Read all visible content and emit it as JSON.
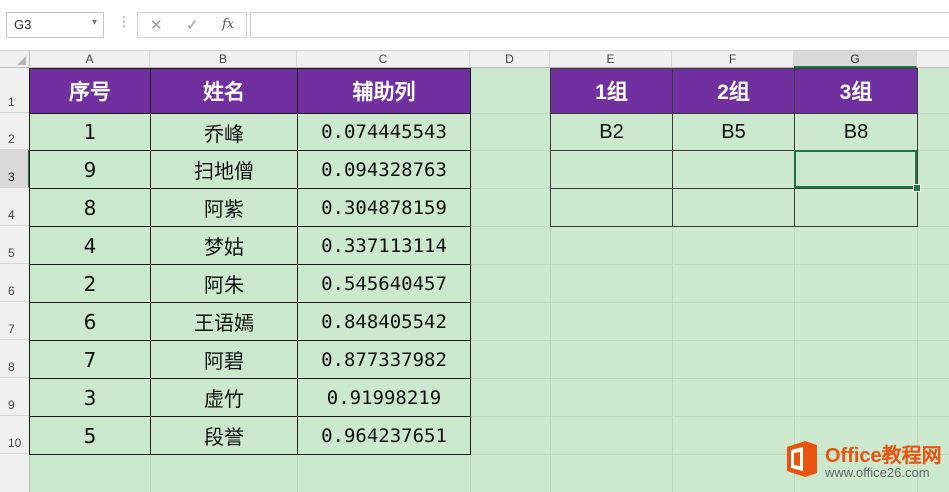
{
  "name_box": {
    "value": "G3",
    "arrow": "▾"
  },
  "formula_bar": {
    "separator": "⋮",
    "cancel": "✕",
    "enter": "✓",
    "fx": "fx",
    "content": ""
  },
  "columns": [
    "A",
    "B",
    "C",
    "D",
    "E",
    "F",
    "G"
  ],
  "rows": [
    "1",
    "2",
    "3",
    "4",
    "5",
    "6",
    "7",
    "8",
    "9",
    "10"
  ],
  "selected_cell": {
    "column": "G",
    "row": "3"
  },
  "main_table": {
    "headers": [
      "序号",
      "姓名",
      "辅助列"
    ],
    "rows": [
      [
        "1",
        "乔峰",
        "0.074445543"
      ],
      [
        "9",
        "扫地僧",
        "0.094328763"
      ],
      [
        "8",
        "阿紫",
        "0.304878159"
      ],
      [
        "4",
        "梦姑",
        "0.337113114"
      ],
      [
        "2",
        "阿朱",
        "0.545640457"
      ],
      [
        "6",
        "王语嫣",
        "0.848405542"
      ],
      [
        "7",
        "阿碧",
        "0.877337982"
      ],
      [
        "3",
        "虚竹",
        "0.91998219"
      ],
      [
        "5",
        "段誉",
        "0.964237651"
      ]
    ]
  },
  "group_table": {
    "headers": [
      "1组",
      "2组",
      "3组"
    ],
    "rows": [
      [
        "B2",
        "B5",
        "B8"
      ],
      [
        "",
        "",
        ""
      ],
      [
        "",
        "",
        ""
      ]
    ]
  },
  "watermark": {
    "title": "Office教程网",
    "url": "www.office26.com",
    "brand_color": "#e8540d"
  },
  "colors": {
    "header_fill": "#7030a0",
    "sheet_bg": "#cce8cf",
    "selection": "#217346"
  }
}
